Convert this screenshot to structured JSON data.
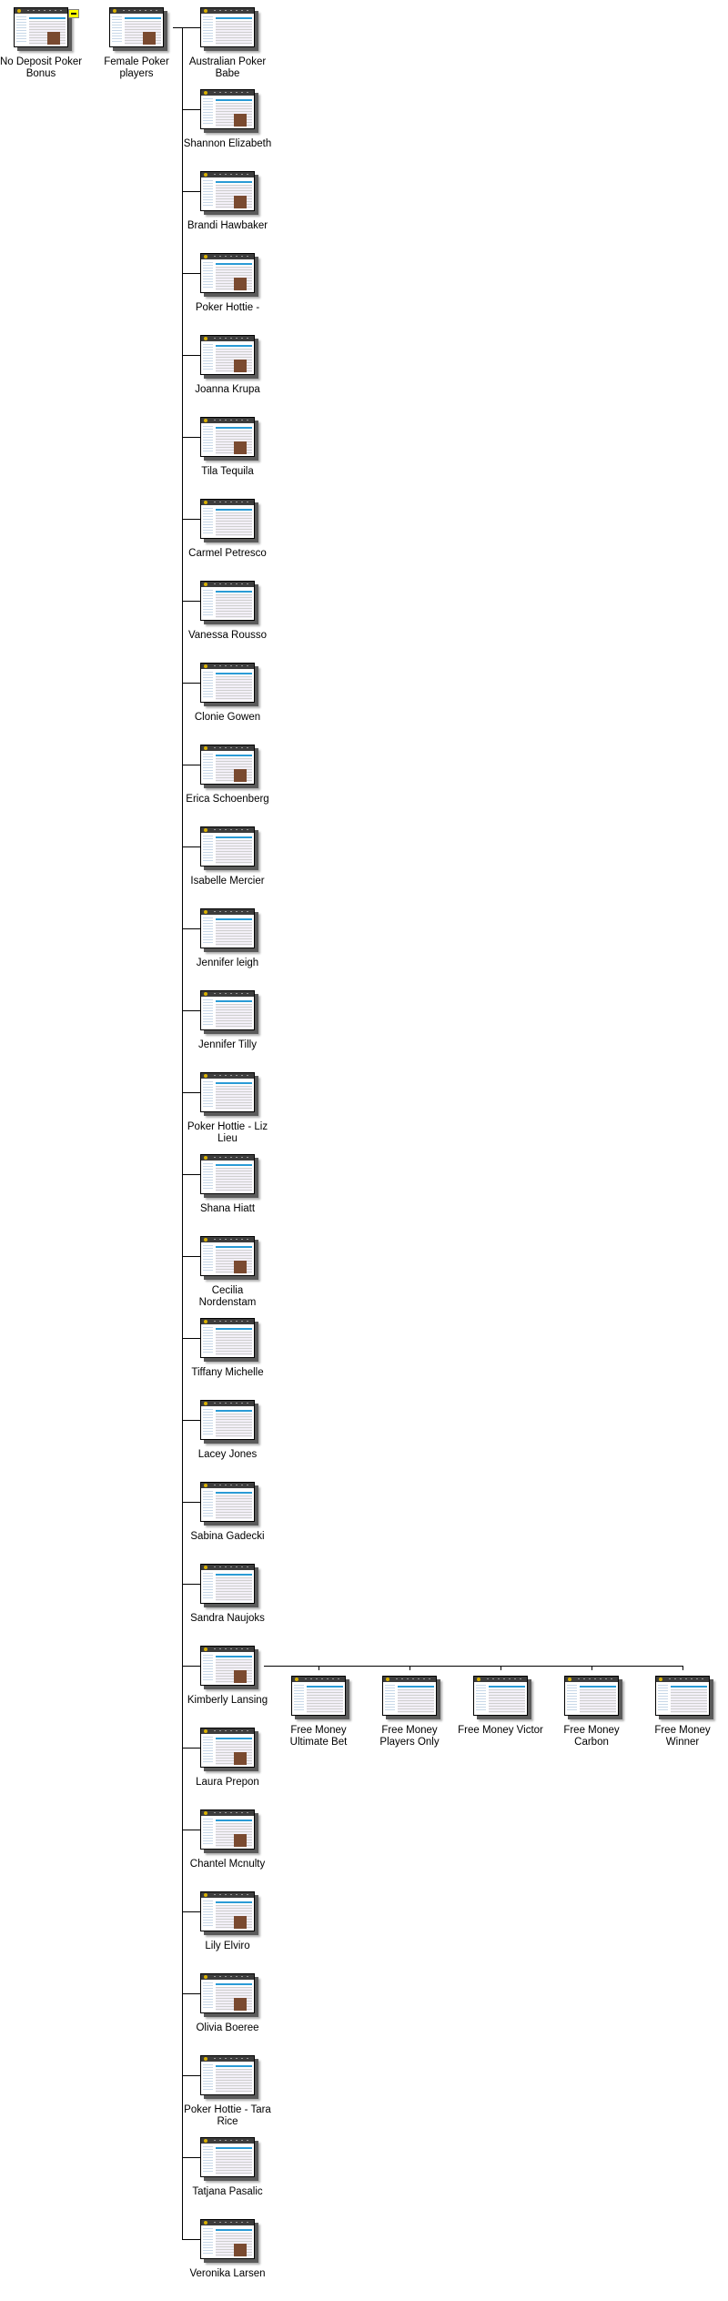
{
  "root": {
    "label": "No Deposit Poker Bonus",
    "toggle": "collapse"
  },
  "parent": {
    "label": "Female Poker players"
  },
  "children": [
    {
      "label": "Australian Poker Babe",
      "pic": false
    },
    {
      "label": "Shannon Elizabeth",
      "pic": true
    },
    {
      "label": "Brandi Hawbaker",
      "pic": true
    },
    {
      "label": "Poker Hottie -",
      "pic": true
    },
    {
      "label": "Joanna Krupa",
      "pic": true
    },
    {
      "label": "Tila Tequila",
      "pic": true
    },
    {
      "label": "Carmel Petresco",
      "pic": false
    },
    {
      "label": "Vanessa Rousso",
      "pic": false
    },
    {
      "label": "Clonie Gowen",
      "pic": false
    },
    {
      "label": "Erica Schoenberg",
      "pic": true
    },
    {
      "label": "Isabelle Mercier",
      "pic": false
    },
    {
      "label": "Jennifer leigh",
      "pic": false
    },
    {
      "label": "Jennifer Tilly",
      "pic": false
    },
    {
      "label": "Poker Hottie - Liz Lieu",
      "pic": false
    },
    {
      "label": "Shana Hiatt",
      "pic": false
    },
    {
      "label": "Cecilia Nordenstam",
      "pic": true
    },
    {
      "label": "Tiffany Michelle",
      "pic": false
    },
    {
      "label": "Lacey Jones",
      "pic": false
    },
    {
      "label": "Sabina Gadecki",
      "pic": false
    },
    {
      "label": "Sandra Naujoks",
      "pic": false
    },
    {
      "label": "Kimberly Lansing",
      "pic": true
    },
    {
      "label": "Laura Prepon",
      "pic": true
    },
    {
      "label": "Chantel Mcnulty",
      "pic": true
    },
    {
      "label": "Lily Elviro",
      "pic": true
    },
    {
      "label": "Olivia Boeree",
      "pic": true
    },
    {
      "label": "Poker Hottie - Tara Rice",
      "pic": false
    },
    {
      "label": "Tatjana Pasalic",
      "pic": false
    },
    {
      "label": "Veronika Larsen",
      "pic": true
    }
  ],
  "expanded_child_index": 20,
  "grandchildren": [
    {
      "label": "Free Money Ultimate Bet"
    },
    {
      "label": "Free Money Players Only"
    },
    {
      "label": "Free Money Victor"
    },
    {
      "label": "Free Money Carbon"
    },
    {
      "label": "Free Money Winner"
    }
  ]
}
